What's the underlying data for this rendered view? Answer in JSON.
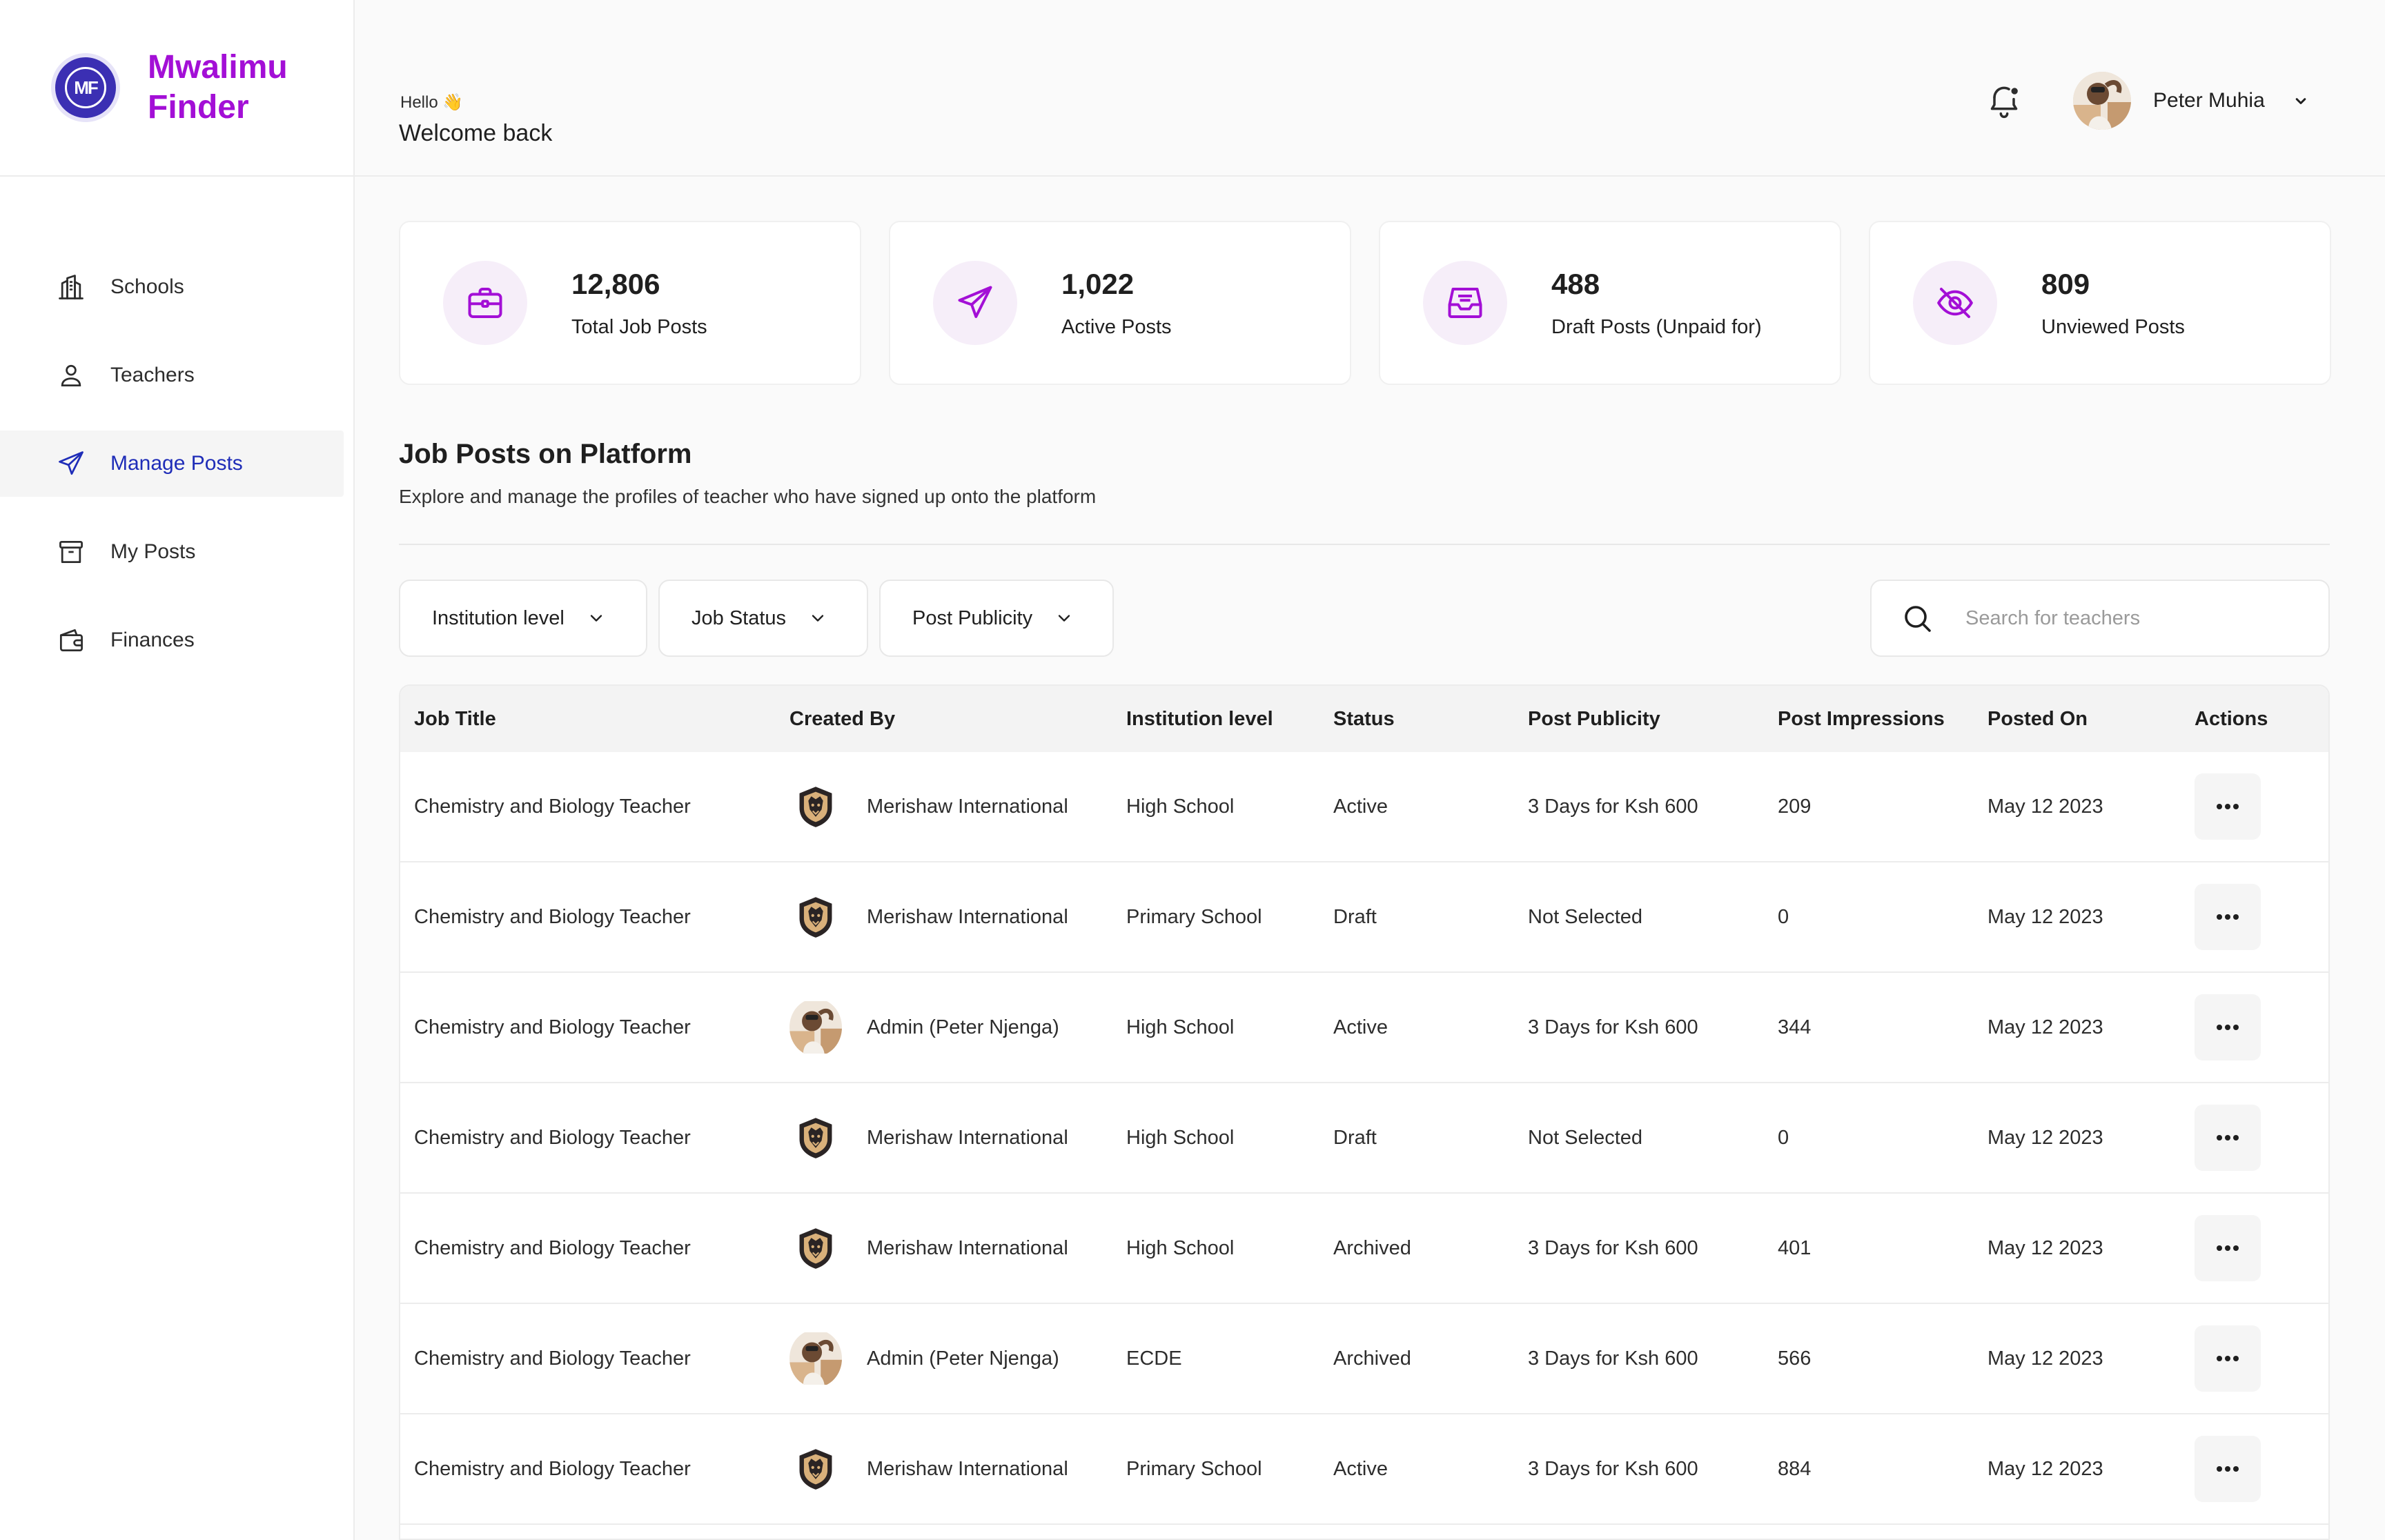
{
  "brand": {
    "name_line1": "Mwalimu",
    "name_line2": "Finder"
  },
  "sidebar": {
    "items": [
      {
        "label": "Schools",
        "icon": "building-icon",
        "active": false
      },
      {
        "label": "Teachers",
        "icon": "user-icon",
        "active": false
      },
      {
        "label": "Manage Posts",
        "icon": "send-icon",
        "active": true
      },
      {
        "label": "My Posts",
        "icon": "archive-icon",
        "active": false
      },
      {
        "label": "Finances",
        "icon": "wallet-icon",
        "active": false
      }
    ]
  },
  "header": {
    "hello": "Hello 👋",
    "welcome": "Welcome back",
    "user_name": "Peter Muhia"
  },
  "stats": [
    {
      "value": "12,806",
      "label": "Total Job Posts",
      "icon": "briefcase-icon"
    },
    {
      "value": "1,022",
      "label": "Active Posts",
      "icon": "send-icon"
    },
    {
      "value": "488",
      "label": "Draft Posts (Unpaid for)",
      "icon": "inbox-icon"
    },
    {
      "value": "809",
      "label": "Unviewed Posts",
      "icon": "eye-off-icon"
    }
  ],
  "section": {
    "title": "Job Posts on Platform",
    "subtitle": "Explore and manage the profiles of teacher who have signed up onto the platform"
  },
  "filters": {
    "institution_level": "Institution level",
    "job_status": "Job Status",
    "post_publicity": "Post Publicity",
    "search_placeholder": "Search for teachers"
  },
  "table": {
    "headers": [
      "Job Title",
      "Created By",
      "Institution level",
      "Status",
      "Post Publicity",
      "Post Impressions",
      "Posted On",
      "Actions"
    ],
    "rows": [
      {
        "title": "Chemistry and Biology Teacher",
        "creator": "Merishaw International",
        "creator_type": "school",
        "level": "High School",
        "status": "Active",
        "publicity": "3 Days for Ksh 600",
        "impressions": "209",
        "posted": "May 12 2023"
      },
      {
        "title": "Chemistry and Biology Teacher",
        "creator": "Merishaw International",
        "creator_type": "school",
        "level": "Primary School",
        "status": "Draft",
        "publicity": "Not Selected",
        "impressions": "0",
        "posted": "May 12 2023"
      },
      {
        "title": "Chemistry and Biology Teacher",
        "creator": "Admin (Peter Njenga)",
        "creator_type": "admin",
        "level": "High School",
        "status": "Active",
        "publicity": "3 Days for Ksh 600",
        "impressions": "344",
        "posted": "May 12 2023"
      },
      {
        "title": "Chemistry and Biology Teacher",
        "creator": "Merishaw International",
        "creator_type": "school",
        "level": "High School",
        "status": "Draft",
        "publicity": "Not Selected",
        "impressions": "0",
        "posted": "May 12 2023"
      },
      {
        "title": "Chemistry and Biology Teacher",
        "creator": "Merishaw International",
        "creator_type": "school",
        "level": "High School",
        "status": "Archived",
        "publicity": "3 Days for Ksh 600",
        "impressions": "401",
        "posted": "May 12 2023"
      },
      {
        "title": "Chemistry and Biology Teacher",
        "creator": "Admin (Peter Njenga)",
        "creator_type": "admin",
        "level": "ECDE",
        "status": "Archived",
        "publicity": "3 Days for Ksh 600",
        "impressions": "566",
        "posted": "May 12 2023"
      },
      {
        "title": "Chemistry and Biology Teacher",
        "creator": "Merishaw International",
        "creator_type": "school",
        "level": "Primary School",
        "status": "Active",
        "publicity": "3 Days for Ksh 600",
        "impressions": "884",
        "posted": "May 12 2023"
      }
    ]
  },
  "colors": {
    "brand": "#a30fd6",
    "nav_active": "#1f2db8",
    "icon_accent": "#a30fd6"
  }
}
